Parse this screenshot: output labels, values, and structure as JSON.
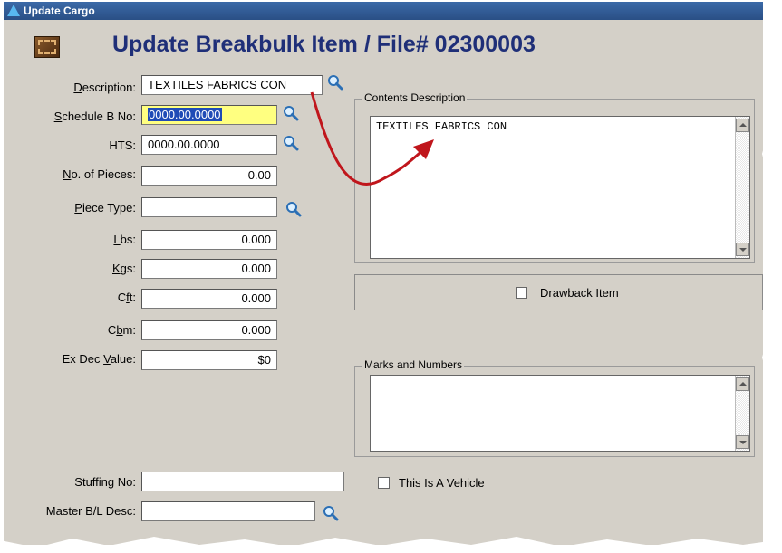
{
  "window": {
    "title": "Update Cargo"
  },
  "header": {
    "title": "Update Breakbulk Item / File# 02300003"
  },
  "form": {
    "description": {
      "label": "Description:",
      "accesskey": "D",
      "value": "TEXTILES FABRICS CON"
    },
    "schedule_b": {
      "label": "Schedule B No:",
      "accesskey": "S",
      "value": "0000.00.0000"
    },
    "hts": {
      "label": "HTS:",
      "value": "0000.00.0000"
    },
    "pieces": {
      "label": "No. of Pieces:",
      "accesskey": "N",
      "value": "0.00"
    },
    "piece_type": {
      "label": "Piece Type:",
      "accesskey": "P",
      "value": ""
    },
    "lbs": {
      "label": "Lbs:",
      "accesskey": "L",
      "value": "0.000"
    },
    "kgs": {
      "label": "Kgs:",
      "accesskey": "K",
      "value": "0.000"
    },
    "cft": {
      "label": "Cft:",
      "accesskey": "f",
      "value": "0.000"
    },
    "cbm": {
      "label": "Cbm:",
      "accesskey": "b",
      "value": "0.000"
    },
    "ex_dec_value": {
      "label": "Ex Dec Value:",
      "accesskey": "V",
      "value": "$0"
    },
    "stuffing_no": {
      "label": "Stuffing No:",
      "value": ""
    },
    "master_bl_desc": {
      "label": "Master B/L Desc:",
      "value": ""
    }
  },
  "contents": {
    "title": "Contents Description",
    "text": "TEXTILES FABRICS CON"
  },
  "drawback": {
    "label": "Drawback Item",
    "checked": false
  },
  "marks": {
    "title": "Marks and Numbers",
    "text": ""
  },
  "vehicle": {
    "label": "This Is A Vehicle",
    "checked": false
  },
  "colors": {
    "title_blue": "#1f2f78",
    "highlight": "#ffff80",
    "arrow": "#c0161c"
  }
}
